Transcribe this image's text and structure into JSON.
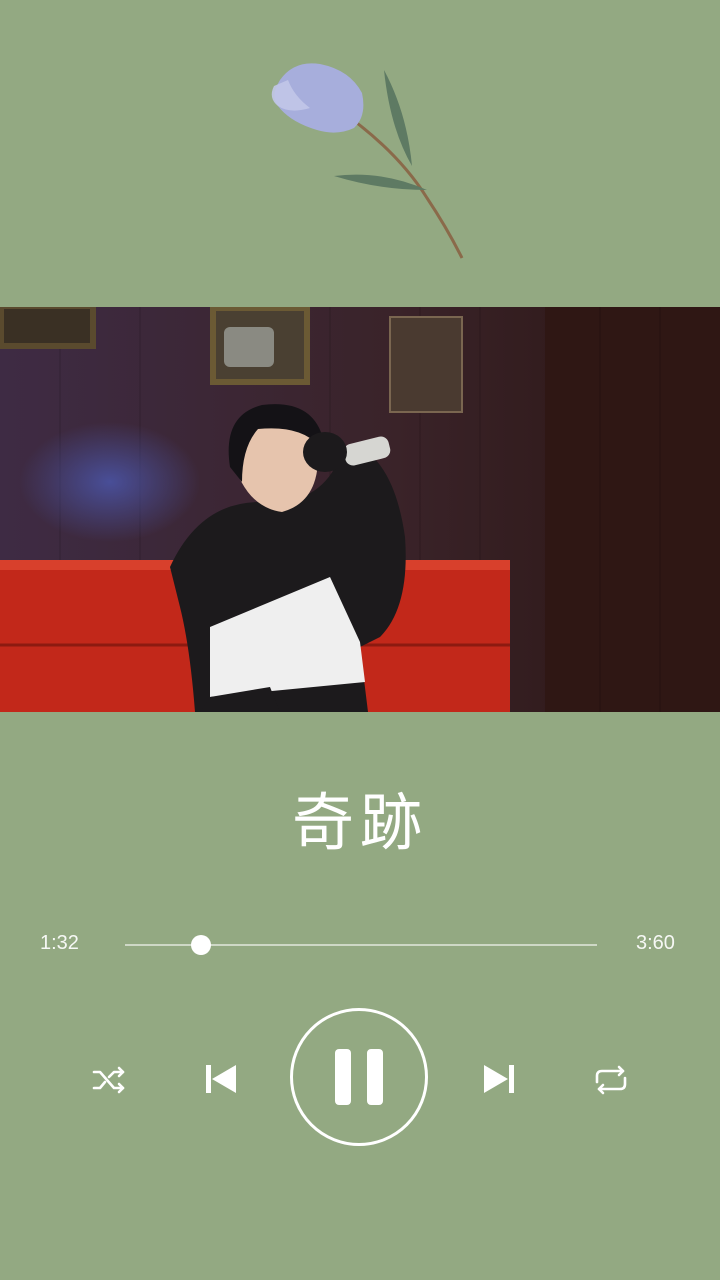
{
  "player": {
    "title": "奇跡",
    "elapsed": "1:32",
    "total": "3:60",
    "progress_fraction": 0.16
  },
  "controls": {
    "shuffle_icon": "shuffle-icon",
    "previous_icon": "skip-previous-icon",
    "play_state_icon": "pause-icon",
    "next_icon": "skip-next-icon",
    "repeat_icon": "repeat-icon"
  },
  "colors": {
    "background": "#93a982",
    "foreground": "#ffffff",
    "flower_petal": "#a7aedc",
    "flower_leaf": "#5e7a63"
  },
  "media": {
    "content": "karaoke-video-frame"
  }
}
